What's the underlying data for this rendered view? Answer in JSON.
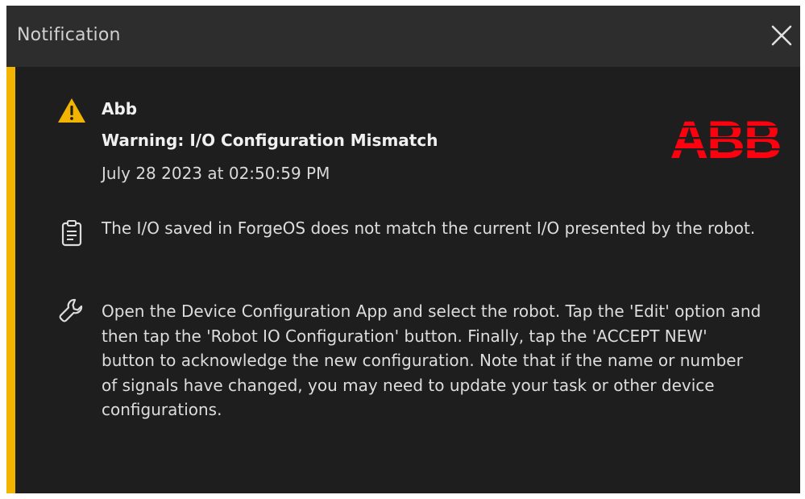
{
  "dialog": {
    "title": "Notification",
    "close_icon": "close-icon"
  },
  "notification": {
    "severity": "warning",
    "severity_color": "#f3b400",
    "source": "Abb",
    "headline": "Warning: I/O Configuration Mismatch",
    "timestamp": "July 28 2023 at 02:50:59 PM",
    "logo_text": "ABB",
    "logo_color": "#ff000f",
    "description_icon": "clipboard-icon",
    "description": "The I/O saved in ForgeOS does not match the current I/O presented by the robot.",
    "resolution_icon": "wrench-icon",
    "resolution": "Open the Device Configuration App and select the robot. Tap the 'Edit' option and then tap the 'Robot IO Configuration' button. Finally, tap the 'ACCEPT NEW' button to acknowledge the new configuration. Note that if the name or number of signals have changed, you may need to update your task or other device configurations."
  }
}
